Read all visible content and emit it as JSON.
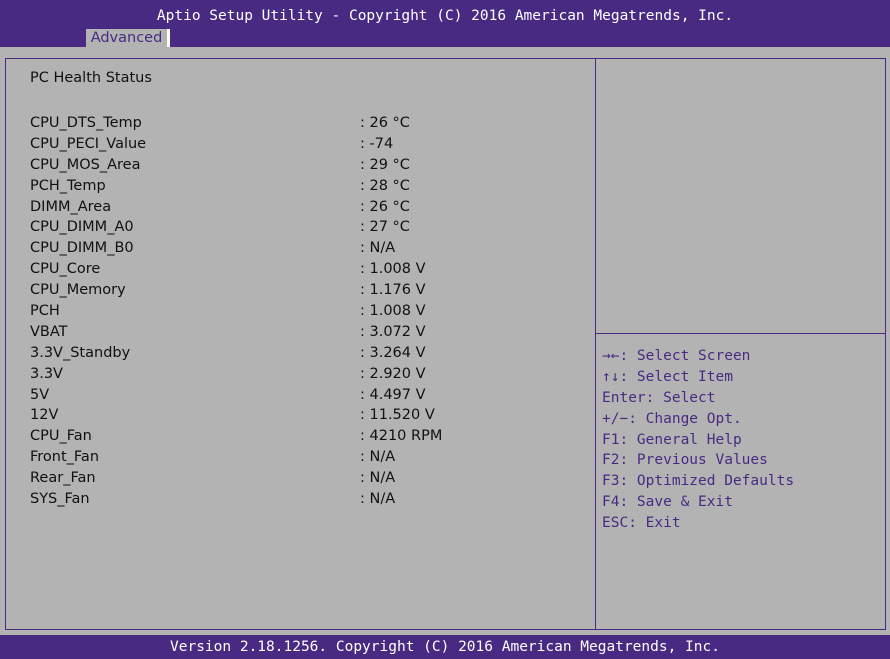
{
  "header": {
    "title": "Aptio Setup Utility - Copyright (C) 2016 American Megatrends, Inc.",
    "tabs": [
      {
        "label": "Advanced",
        "active": true
      }
    ]
  },
  "main": {
    "section_title": "PC Health Status",
    "items": [
      {
        "label": "CPU_DTS_Temp",
        "value": ": 26 °C"
      },
      {
        "label": "CPU_PECI_Value",
        "value": ": -74"
      },
      {
        "label": "CPU_MOS_Area",
        "value": ": 29 °C"
      },
      {
        "label": "PCH_Temp",
        "value": ": 28 °C"
      },
      {
        "label": "DIMM_Area",
        "value": ": 26 °C"
      },
      {
        "label": "CPU_DIMM_A0",
        "value": ": 27 °C"
      },
      {
        "label": "CPU_DIMM_B0",
        "value": ": N/A"
      },
      {
        "label": "CPU_Core",
        "value": ": 1.008 V"
      },
      {
        "label": "CPU_Memory",
        "value": ": 1.176 V"
      },
      {
        "label": "PCH",
        "value": ": 1.008 V"
      },
      {
        "label": "VBAT",
        "value": ": 3.072 V"
      },
      {
        "label": "3.3V_Standby",
        "value": ": 3.264 V"
      },
      {
        "label": "3.3V",
        "value": ": 2.920 V"
      },
      {
        "label": "5V",
        "value": ": 4.497 V"
      },
      {
        "label": "12V",
        "value": ": 11.520 V"
      },
      {
        "label": "CPU_Fan",
        "value": ": 4210 RPM"
      },
      {
        "label": "Front_Fan",
        "value": ": N/A"
      },
      {
        "label": "Rear_Fan",
        "value": ": N/A"
      },
      {
        "label": "SYS_Fan",
        "value": ": N/A"
      }
    ]
  },
  "help": {
    "items": [
      "→←: Select Screen",
      "↑↓: Select Item",
      "Enter: Select",
      "+/−: Change Opt.",
      "F1: General Help",
      "F2: Previous Values",
      "F3: Optimized Defaults",
      "F4: Save & Exit",
      "ESC: Exit"
    ]
  },
  "footer": {
    "text": "Version 2.18.1256. Copyright (C) 2016 American Megatrends, Inc."
  },
  "colors": {
    "bar_background": "#482a83",
    "panel_background": "#b3b3b3",
    "help_text": "#482a83",
    "body_text": "#111111"
  }
}
